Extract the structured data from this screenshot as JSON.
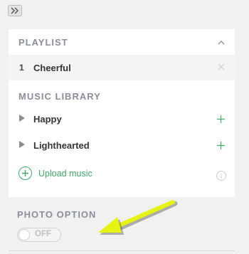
{
  "toolbar": {
    "collapse_icon": "double-chevron-right-icon"
  },
  "playlist": {
    "title": "PLAYLIST",
    "collapse_icon": "chevron-up-icon",
    "items": [
      {
        "index": "1",
        "name": "Cheerful",
        "remove_icon": "close-icon"
      }
    ]
  },
  "library": {
    "title": "MUSIC LIBRARY",
    "items": [
      {
        "name": "Happy",
        "expand_icon": "triangle-right-icon",
        "add_icon": "plus-icon"
      },
      {
        "name": "Lighthearted",
        "expand_icon": "triangle-right-icon",
        "add_icon": "plus-icon"
      }
    ],
    "upload_label": "Upload music",
    "upload_icon": "plus-circle-icon",
    "info_icon": "info-icon"
  },
  "photo_option": {
    "title": "PHOTO OPTION",
    "toggle_label": "OFF",
    "toggle_state": false
  },
  "annotation": {
    "arrow_color": "#e6f20f"
  },
  "colors": {
    "accent_green": "#42a86a",
    "section_title": "#8a8e99",
    "background": "#f1f1f1"
  }
}
